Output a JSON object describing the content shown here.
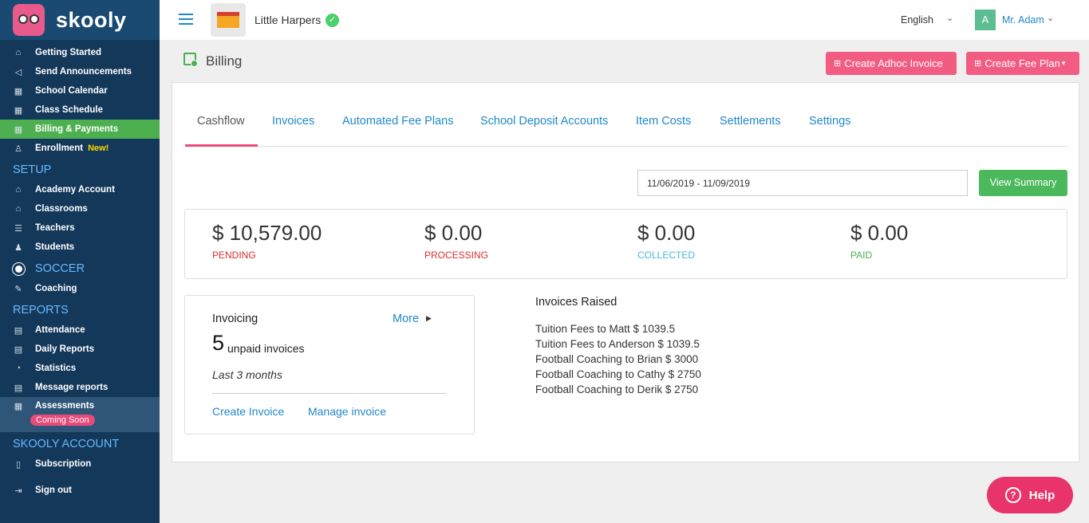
{
  "app": {
    "logo_text": "skooly"
  },
  "sidebar": {
    "items": [
      {
        "label": "Getting Started",
        "icon": "home-icon",
        "glyph": "⌂"
      },
      {
        "label": "Send Announcements",
        "icon": "megaphone-icon",
        "glyph": "📢"
      },
      {
        "label": "School Calendar",
        "icon": "calendar-icon",
        "glyph": "▦"
      },
      {
        "label": "Class Schedule",
        "icon": "calendar-icon",
        "glyph": "▦"
      },
      {
        "label": "Billing & Payments",
        "icon": "calendar-icon",
        "glyph": "▦"
      },
      {
        "label": "Enrollment",
        "icon": "user-add-icon",
        "glyph": "♙",
        "badge": "New!"
      }
    ],
    "setup_heading": "SETUP",
    "setup_items": [
      {
        "label": "Academy Account",
        "icon": "building-icon",
        "glyph": "⌂"
      },
      {
        "label": "Classrooms",
        "icon": "classroom-icon",
        "glyph": "⌂"
      },
      {
        "label": "Teachers",
        "icon": "teacher-icon",
        "glyph": "☰"
      },
      {
        "label": "Students",
        "icon": "student-icon",
        "glyph": "♟"
      }
    ],
    "soccer_heading": "SOCCER",
    "soccer_items": [
      {
        "label": "Coaching",
        "icon": "whistle-icon",
        "glyph": "✎"
      }
    ],
    "reports_heading": "REPORTS",
    "reports_items": [
      {
        "label": "Attendance",
        "icon": "report-icon",
        "glyph": "▤"
      },
      {
        "label": "Daily Reports",
        "icon": "report-icon",
        "glyph": "▤"
      },
      {
        "label": "Statistics",
        "icon": "pie-chart-icon",
        "glyph": "◔"
      },
      {
        "label": "Message reports",
        "icon": "report-icon",
        "glyph": "▤"
      },
      {
        "label": "Assessments",
        "icon": "calendar-icon",
        "glyph": "▦",
        "badge": "Coming Soon"
      }
    ],
    "account_heading": "SKOOLY ACCOUNT",
    "account_items": [
      {
        "label": "Subscription",
        "icon": "bookmark-icon",
        "glyph": "▯"
      },
      {
        "label": "Sign out",
        "icon": "sign-out-icon",
        "glyph": "⇥"
      }
    ]
  },
  "topbar": {
    "school_name": "Little Harpers",
    "language": "English",
    "user_initial": "A",
    "user_name": "Mr. Adam"
  },
  "page": {
    "title": "Billing",
    "btn_adhoc": "Create Adhoc Invoice",
    "btn_feeplan": "Create Fee Plan"
  },
  "tabs": [
    "Cashflow",
    "Invoices",
    "Automated Fee Plans",
    "School Deposit Accounts",
    "Item Costs",
    "Settlements",
    "Settings"
  ],
  "filters": {
    "date_range": "11/06/2019 - 11/09/2019",
    "btn_summary": "View Summary"
  },
  "stats": [
    {
      "value": "$ 10,579.00",
      "label": "PENDING",
      "color": "#d9302c"
    },
    {
      "value": "$ 0.00",
      "label": "PROCESSING",
      "color": "#d9302c"
    },
    {
      "value": "$ 0.00",
      "label": "COLLECTED",
      "color": "#4bb8d9"
    },
    {
      "value": "$ 0.00",
      "label": "PAID",
      "color": "#4caf50"
    }
  ],
  "invoicing": {
    "title": "Invoicing",
    "more": "More",
    "count": "5",
    "count_label": "unpaid invoices",
    "period": "Last 3 months",
    "create_link": "Create Invoice",
    "manage_link": "Manage invoice"
  },
  "invoices_raised": {
    "title": "Invoices Raised",
    "items": [
      "Tuition Fees to Matt $ 1039.5",
      "Tuition Fees to Anderson $ 1039.5",
      "Football Coaching to Brian $ 3000",
      "Football Coaching to Cathy $ 2750",
      "Football Coaching to Derik $ 2750"
    ]
  },
  "help": {
    "label": "Help"
  }
}
